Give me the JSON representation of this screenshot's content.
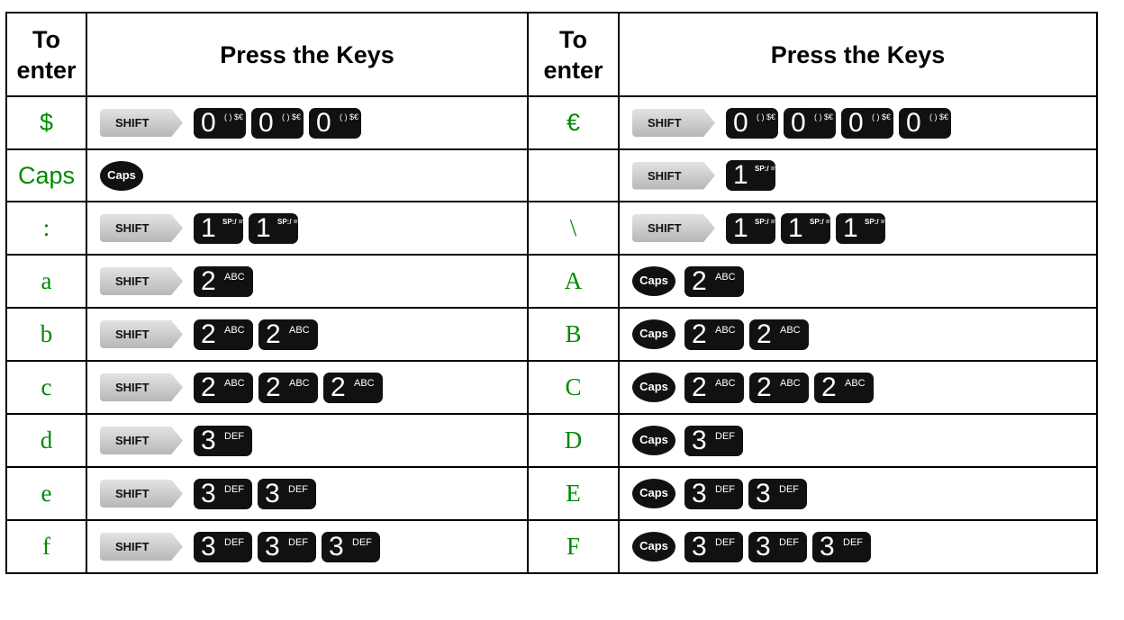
{
  "headers": {
    "to_enter": "To enter",
    "press_keys": "Press the Keys",
    "to_enter_2": "To enter",
    "press_keys_2": "Press the Keys"
  },
  "key_labels": {
    "shift": "SHIFT",
    "caps": "Caps",
    "k0_digit": "0",
    "k0_sub": "( ) $€",
    "k1_digit": "1",
    "k1_sub": "SP:/ =%",
    "k2_digit": "2",
    "k2_sub": "ABC",
    "k3_digit": "3",
    "k3_sub": "DEF"
  },
  "text_color": "#008a00",
  "rows": [
    {
      "left": "$",
      "left_keys": [
        "shift",
        "k0",
        "k0",
        "k0"
      ],
      "right": "€",
      "right_keys": [
        "shift",
        "k0",
        "k0",
        "k0",
        "k0"
      ]
    },
    {
      "left": "Caps",
      "left_keys": [
        "caps"
      ],
      "right": "",
      "right_keys": [
        "shift",
        "k1"
      ]
    },
    {
      "left": ":",
      "left_keys": [
        "shift",
        "k1",
        "k1"
      ],
      "right": "\\",
      "right_keys": [
        "shift",
        "k1",
        "k1",
        "k1"
      ]
    },
    {
      "left": "a",
      "left_keys": [
        "shift",
        "k2"
      ],
      "right": "A",
      "right_keys": [
        "caps",
        "k2"
      ]
    },
    {
      "left": "b",
      "left_keys": [
        "shift",
        "k2",
        "k2"
      ],
      "right": "B",
      "right_keys": [
        "caps",
        "k2",
        "k2"
      ]
    },
    {
      "left": "c",
      "left_keys": [
        "shift",
        "k2",
        "k2",
        "k2"
      ],
      "right": "C",
      "right_keys": [
        "caps",
        "k2",
        "k2",
        "k2"
      ]
    },
    {
      "left": "d",
      "left_keys": [
        "shift",
        "k3"
      ],
      "right": "D",
      "right_keys": [
        "caps",
        "k3"
      ]
    },
    {
      "left": "e",
      "left_keys": [
        "shift",
        "k3",
        "k3"
      ],
      "right": "E",
      "right_keys": [
        "caps",
        "k3",
        "k3"
      ]
    },
    {
      "left": "f",
      "left_keys": [
        "shift",
        "k3",
        "k3",
        "k3"
      ],
      "right": "F",
      "right_keys": [
        "caps",
        "k3",
        "k3",
        "k3"
      ]
    }
  ]
}
